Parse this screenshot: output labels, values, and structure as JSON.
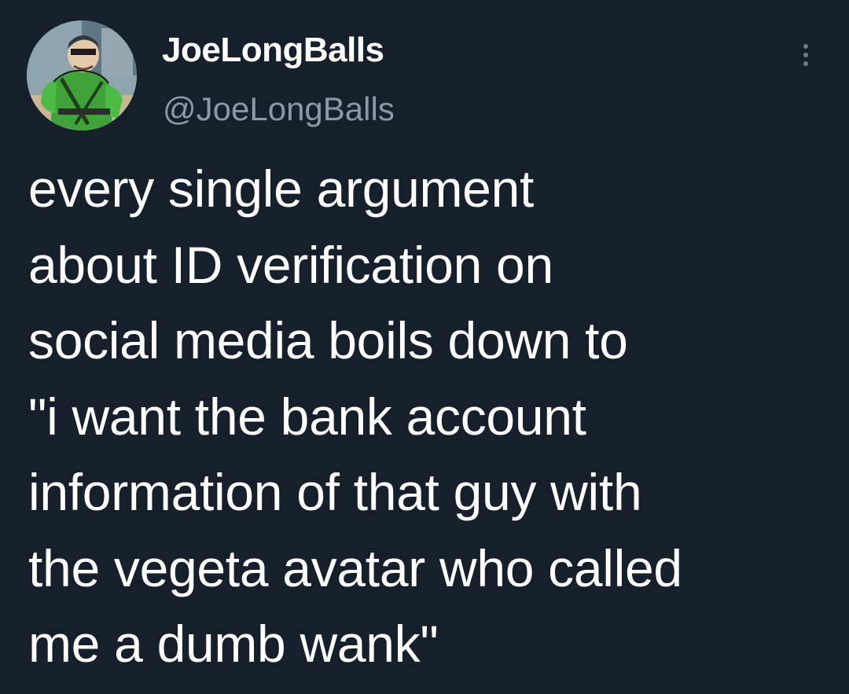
{
  "author": {
    "display_name": "JoeLongBalls",
    "handle": "@JoeLongBalls",
    "avatar": "cartoon-soldier-avatar"
  },
  "menu": {
    "icon": "more-vertical-icon"
  },
  "tweet": {
    "lines": [
      "every single argument",
      "about ID verification on",
      "social media boils down to",
      "\"i want the bank account",
      "information of that guy with",
      "the vegeta avatar who called",
      "me a dumb wank\""
    ]
  },
  "colors": {
    "background": "#15202b",
    "text": "#ffffff",
    "secondary_text": "#8b98a5"
  }
}
